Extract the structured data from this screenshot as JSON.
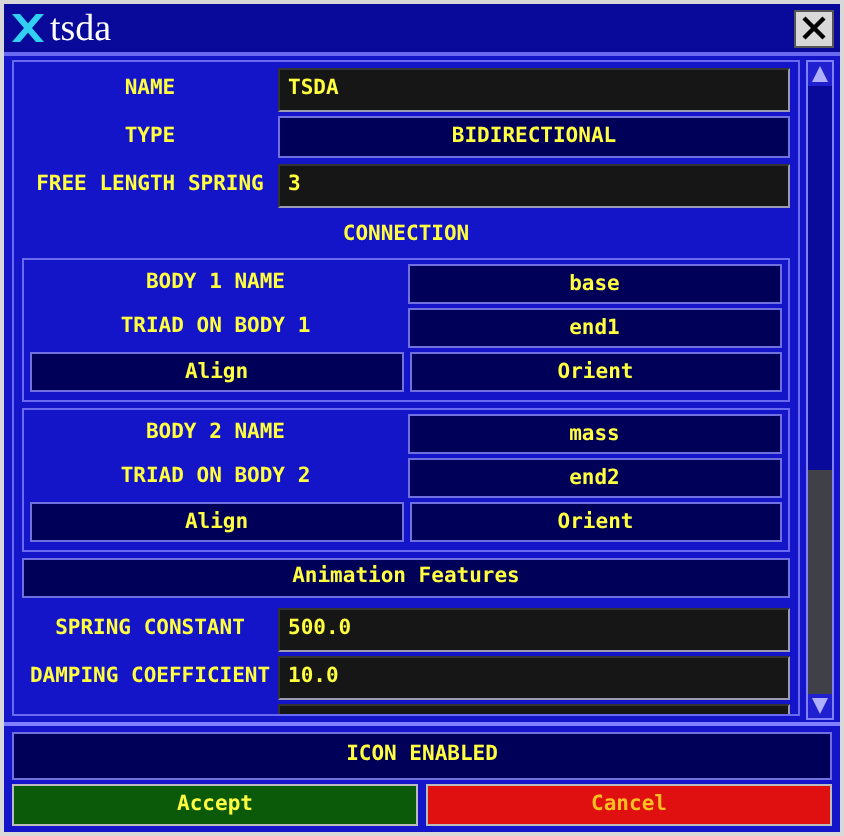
{
  "window": {
    "title": "tsda"
  },
  "fields": [
    {
      "label": "NAME",
      "kind": "input",
      "value": "TSDA"
    },
    {
      "label": "TYPE",
      "kind": "select",
      "value": "BIDIRECTIONAL"
    },
    {
      "label": "FREE LENGTH SPRING",
      "kind": "input",
      "value": "3"
    }
  ],
  "connection": {
    "heading": "CONNECTION",
    "bodies": [
      {
        "name_label": "BODY 1 NAME",
        "name": "base",
        "triad_label": "TRIAD ON BODY 1",
        "triad": "end1",
        "buttons": [
          "Align",
          "Orient"
        ]
      },
      {
        "name_label": "BODY 2 NAME",
        "name": "mass",
        "triad_label": "TRIAD ON BODY 2",
        "triad": "end2",
        "buttons": [
          "Align",
          "Orient"
        ]
      }
    ]
  },
  "animation_button": "Animation Features",
  "properties": [
    {
      "label": "SPRING CONSTANT",
      "value": "500.0"
    },
    {
      "label": "DAMPING COEFFICIENT",
      "value": "10.0"
    }
  ],
  "icon_toggle": "ICON ENABLED",
  "buttons": [
    {
      "label": "Accept",
      "kind": "accept"
    },
    {
      "label": "Cancel",
      "kind": "cancel"
    }
  ]
}
